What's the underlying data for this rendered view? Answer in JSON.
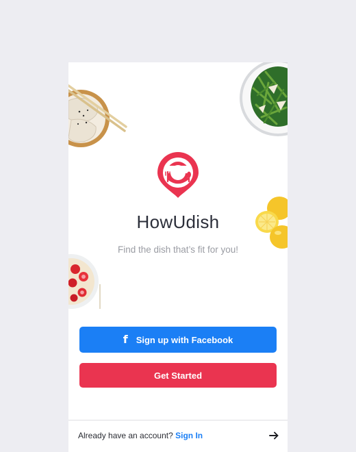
{
  "app": {
    "name": "HowUdish",
    "tagline": "Find the dish that’s fit for you!"
  },
  "buttons": {
    "facebook_label": "Sign up with Facebook",
    "facebook_icon": "f",
    "get_started_label": "Get Started"
  },
  "footer": {
    "prompt": "Already have an account?",
    "signin_label": "Sign In",
    "arrow_icon": "arrow-right-icon"
  },
  "colors": {
    "brand_red": "#ea3450",
    "facebook_blue": "#1b7ff5",
    "background": "#ededf2"
  }
}
